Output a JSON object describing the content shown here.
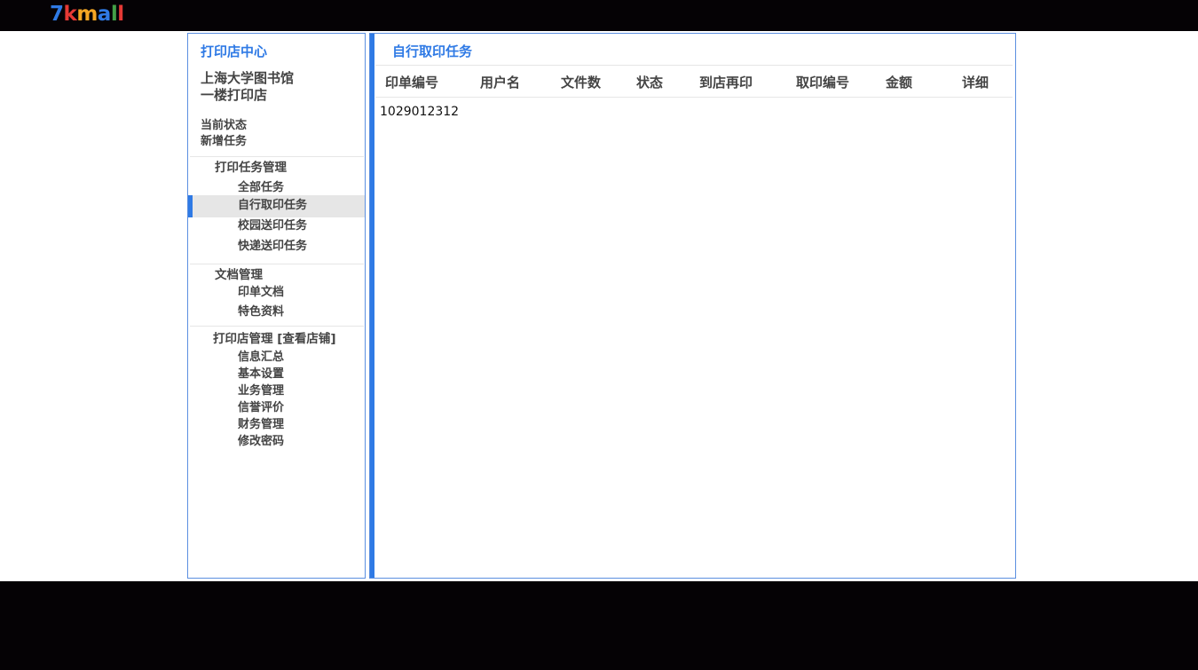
{
  "logo": {
    "chars": [
      {
        "c": "7",
        "color": "#2f7ae5"
      },
      {
        "c": "k",
        "color": "#e53935"
      },
      {
        "c": "m",
        "color": "#f5a623"
      },
      {
        "c": "a",
        "color": "#2f7ae5"
      },
      {
        "c": "l",
        "color": "#43a047"
      },
      {
        "c": "l",
        "color": "#e53935"
      }
    ]
  },
  "sidebar": {
    "title": "打印店中心",
    "shop_line1": "上海大学图书馆",
    "shop_line2": "一楼打印店",
    "current_status": "当前状态",
    "new_task": "新增任务",
    "groups": [
      {
        "label": "打印任务管理",
        "items": [
          "全部任务",
          "自行取印任务",
          "校园送印任务",
          "快递送印任务"
        ]
      },
      {
        "label": "文档管理",
        "items": [
          "印单文档",
          "特色资料"
        ]
      },
      {
        "label": "打印店管理",
        "extra": "[查看店铺]",
        "items": [
          "信息汇总",
          "基本设置",
          "业务管理",
          "信誉评价",
          "财务管理",
          "修改密码"
        ]
      }
    ],
    "active_item": "自行取印任务"
  },
  "main": {
    "title": "自行取印任务",
    "columns": [
      "印单编号",
      "用户名",
      "文件数",
      "状态",
      "到店再印",
      "取印编号",
      "金额",
      "详细"
    ],
    "rows": [
      {
        "order_no": "1029012312"
      }
    ]
  },
  "colors": {
    "accent": "#2f7ae5",
    "border": "#5b8fe0",
    "text": "#444444",
    "active_bg": "#e6e6e6"
  }
}
